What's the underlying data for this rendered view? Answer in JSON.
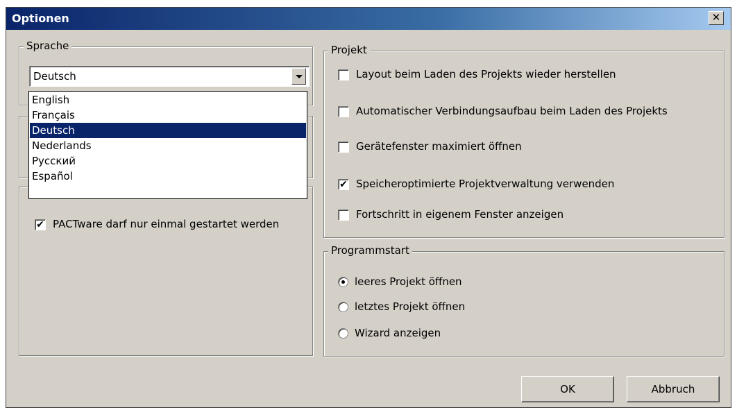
{
  "window": {
    "title": "Optionen",
    "close_label": "✕"
  },
  "language": {
    "legend": "Sprache",
    "selected": "Deutsch",
    "options": [
      "English",
      "Français",
      "Deutsch",
      "Nederlands",
      "Русский",
      "Español"
    ],
    "highlighted_index": 2
  },
  "general": {
    "single_instance_label": "PACTware darf nur einmal gestartet werden",
    "single_instance_checked": true
  },
  "project": {
    "legend": "Projekt",
    "options": [
      {
        "label": "Layout beim Laden des Projekts wieder herstellen",
        "checked": false
      },
      {
        "label": "Automatischer Verbindungsaufbau beim Laden des Projekts",
        "checked": false
      },
      {
        "label": "Gerätefenster maximiert öffnen",
        "checked": false
      },
      {
        "label": "Speicheroptimierte Projektverwaltung verwenden",
        "checked": true
      },
      {
        "label": "Fortschritt in eigenem Fenster anzeigen",
        "checked": false
      }
    ]
  },
  "startup": {
    "legend": "Programmstart",
    "options": [
      {
        "label": "leeres Projekt öffnen",
        "selected": true
      },
      {
        "label": "letztes Projekt öffnen",
        "selected": false
      },
      {
        "label": "Wizard anzeigen",
        "selected": false
      }
    ]
  },
  "buttons": {
    "ok": "OK",
    "cancel": "Abbruch"
  },
  "colors": {
    "title_start": "#0a246a",
    "title_end": "#a6caf0",
    "selection": "#0a246a",
    "face": "#d4d0c8"
  }
}
